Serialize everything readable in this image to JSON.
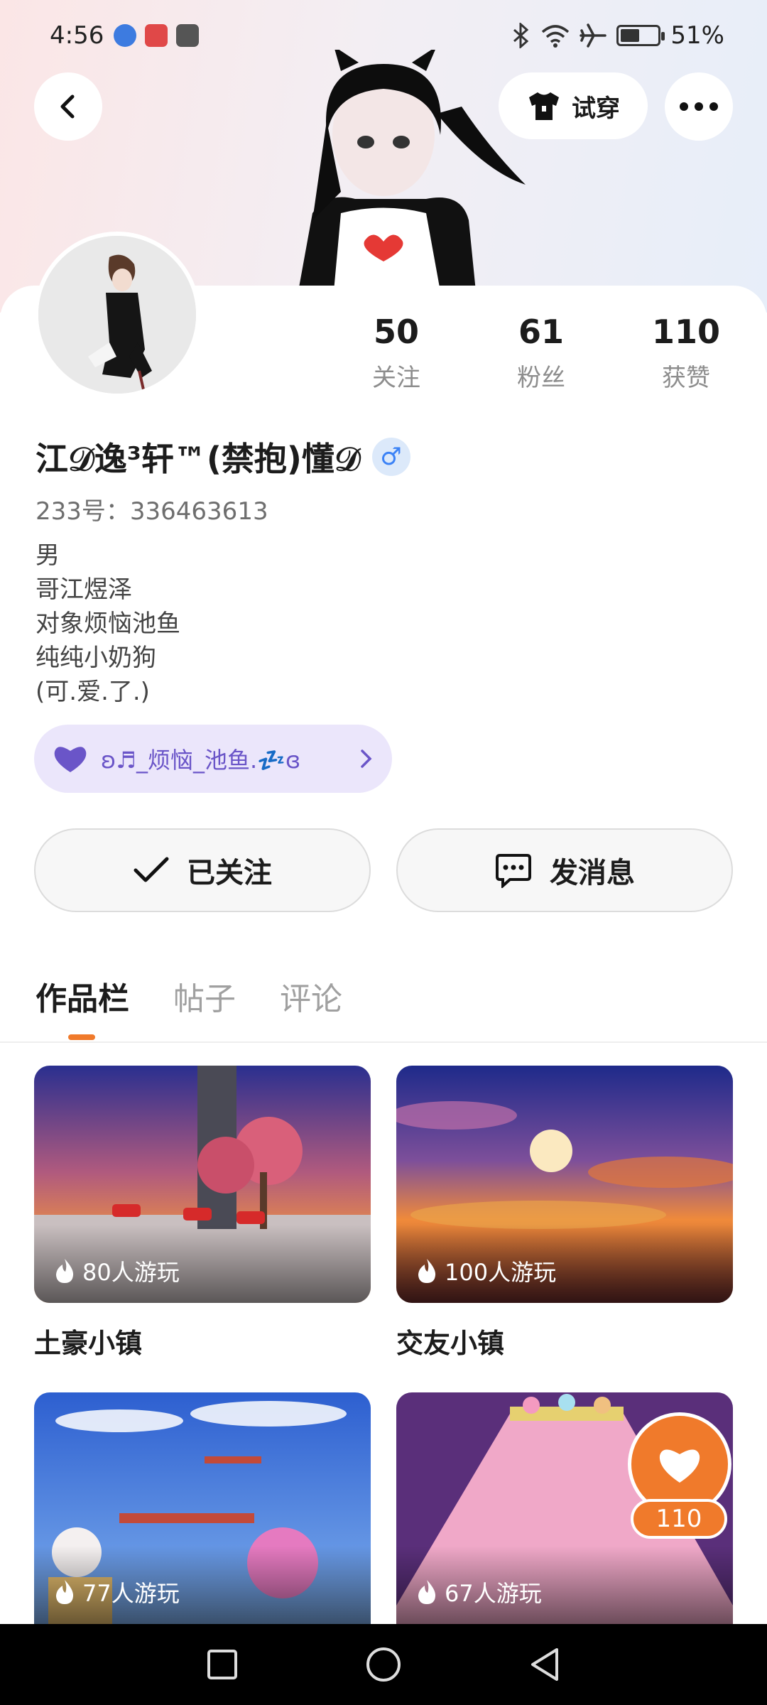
{
  "status_bar": {
    "time": "4:56",
    "battery": "51%",
    "battery_level": 0.51
  },
  "header": {
    "try_on_label": "试穿"
  },
  "stats": [
    {
      "value": "50",
      "label": "关注"
    },
    {
      "value": "61",
      "label": "粉丝"
    },
    {
      "value": "110",
      "label": "获赞"
    }
  ],
  "profile": {
    "name": "江𝒟逸³轩™(禁抱)懂𝒟",
    "gender_symbol": "♂",
    "uid": "233号：336463613",
    "bio_lines": [
      "男",
      "哥江煜泽",
      "对象烦恼池鱼",
      "纯纯小奶狗",
      "(可.爱.了.)"
    ]
  },
  "group": {
    "label": "ʚ♬_烦恼_池鱼.💤ɞ"
  },
  "actions": {
    "followed_label": "已关注",
    "message_label": "发消息"
  },
  "tabs": [
    "作品栏",
    "帖子",
    "评论"
  ],
  "works": [
    {
      "title": "土豪小镇",
      "plays": "80人游玩"
    },
    {
      "title": "交友小镇",
      "plays": "100人游玩"
    },
    {
      "title": "",
      "plays": "77人游玩"
    },
    {
      "title": "",
      "plays": "67人游玩"
    }
  ],
  "like_fab": {
    "count": "110"
  },
  "colors": {
    "accent": "#f07a2b",
    "group_bg": "#ebe6fb",
    "group_text": "#6a55c8",
    "gender_blue": "#3b82f6"
  },
  "icons": [
    "back-icon",
    "shirt-icon",
    "more-icon",
    "check-icon",
    "chat-icon",
    "flame-icon",
    "heart-icon",
    "square-nav-icon",
    "circle-nav-icon",
    "triangle-nav-icon"
  ]
}
